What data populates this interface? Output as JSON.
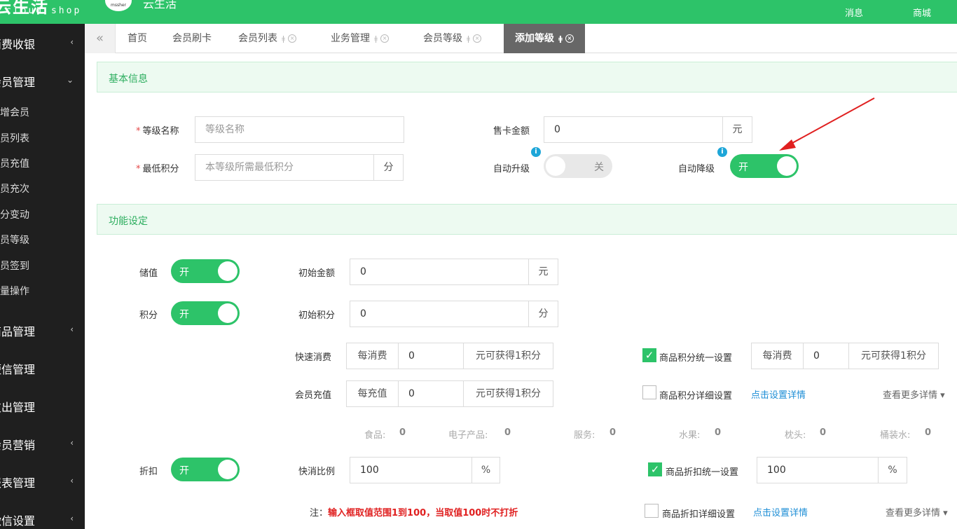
{
  "topbar": {
    "brand": "云生活",
    "brand_sub": "cloud shop",
    "avatar_text": "mssher",
    "title": "云生活",
    "messages": "消息",
    "mall": "商城"
  },
  "sidebar": {
    "items": [
      {
        "label": "消费收银",
        "arrow": "‹"
      },
      {
        "label": "会员管理",
        "arrow": "⌄"
      },
      {
        "label": "商品管理",
        "arrow": "‹"
      },
      {
        "label": "短信管理",
        "arrow": ""
      },
      {
        "label": "支出管理",
        "arrow": ""
      },
      {
        "label": "会员营销",
        "arrow": "‹"
      },
      {
        "label": "报表管理",
        "arrow": "‹"
      },
      {
        "label": "微信设置",
        "arrow": "‹"
      }
    ],
    "subitems": [
      "新增会员",
      "会员列表",
      "会员充值",
      "会员充次",
      "积分变动",
      "会员等级",
      "会员签到",
      "批量操作"
    ]
  },
  "tabs": {
    "nav": "«",
    "items": [
      {
        "label": "首页"
      },
      {
        "label": "会员刷卡"
      },
      {
        "label": "会员列表"
      },
      {
        "label": "业务管理"
      },
      {
        "label": "会员等级"
      },
      {
        "label": "添加等级"
      }
    ],
    "pin": "ǂ",
    "close": "×"
  },
  "basic": {
    "section_title": "基本信息",
    "required_mark": "*",
    "level_name_label": "等级名称",
    "level_name_placeholder": "等级名称",
    "min_points_label": "最低积分",
    "min_points_placeholder": "本等级所需最低积分",
    "min_points_unit": "分",
    "card_price_label": "售卡金额",
    "card_price_value": "0",
    "card_price_unit": "元",
    "auto_upgrade_label": "自动升级",
    "auto_upgrade_state": "关",
    "auto_downgrade_label": "自动降级",
    "auto_downgrade_state": "开",
    "info_icon": "i"
  },
  "features": {
    "section_title": "功能设定",
    "stored_value_label": "储值",
    "stored_value_state": "开",
    "initial_amount_label": "初始金额",
    "initial_amount_value": "0",
    "initial_amount_unit": "元",
    "points_label": "积分",
    "points_state": "开",
    "initial_points_label": "初始积分",
    "initial_points_value": "0",
    "initial_points_unit": "分",
    "quick_consume_label": "快速消费",
    "quick_consume_prefix": "每消费",
    "quick_consume_value": "0",
    "quick_consume_suffix": "元可获得1积分",
    "recharge_label": "会员充值",
    "recharge_prefix": "每充值",
    "recharge_value": "0",
    "recharge_suffix": "元可获得1积分",
    "goods_points_unified_label": "商品积分统一设置",
    "goods_points_unified_checked": true,
    "goods_points_prefix": "每消费",
    "goods_points_value": "0",
    "goods_points_suffix": "元可获得1积分",
    "goods_points_detail_label": "商品积分详细设置",
    "goods_points_detail_checked": false,
    "set_details_link": "点击设置详情",
    "more_details": "查看更多详情 ▾",
    "categories": [
      {
        "name": "食品:",
        "value": "0"
      },
      {
        "name": "电子产品:",
        "value": "0"
      },
      {
        "name": "服务:",
        "value": "0"
      },
      {
        "name": "水果:",
        "value": "0"
      },
      {
        "name": "枕头:",
        "value": "0"
      },
      {
        "name": "桶装水:",
        "value": "0"
      }
    ],
    "discount_label": "折扣",
    "discount_state": "开",
    "quick_ratio_label": "快消比例",
    "quick_ratio_value": "100",
    "quick_ratio_unit": "%",
    "goods_discount_unified_label": "商品折扣统一设置",
    "goods_discount_unified_checked": true,
    "goods_discount_value": "100",
    "goods_discount_unit": "%",
    "goods_discount_detail_label": "商品折扣详细设置",
    "goods_discount_detail_checked": false,
    "set_details_link2": "点击设置详情",
    "more_details2": "查看更多详情 ▾",
    "note_prefix": "注：",
    "note_text": "输入框取值范围1到100，当取值100时不打折"
  },
  "check_glyph": "✓",
  "colors": {
    "brand_green": "#2dc369",
    "sidebar_bg": "#1f1f1f",
    "annotation_arrow": "#e02020",
    "link_blue": "#1e8ed6"
  }
}
